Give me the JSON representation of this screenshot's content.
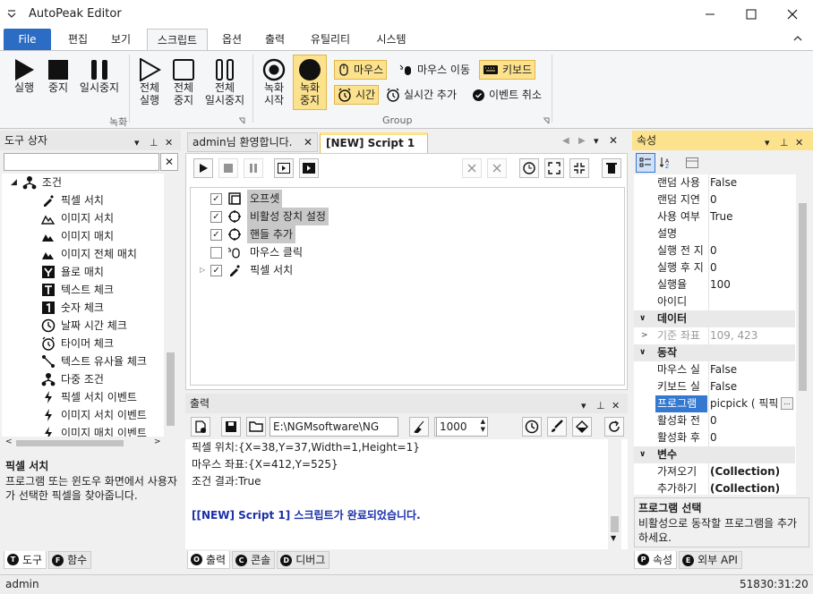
{
  "window": {
    "title": "AutoPeak Editor"
  },
  "ribbon_tabs": [
    "File",
    "편집",
    "보기",
    "스크립트",
    "옵션",
    "출력",
    "유틸리티",
    "시스템"
  ],
  "ribbon": {
    "rec_group": {
      "play": "실행",
      "stop": "중지",
      "pause": "일시중지",
      "play_all": [
        "전체",
        "실행"
      ],
      "stop_all": [
        "전체",
        "중지"
      ],
      "pause_all": [
        "전체",
        "일시중지"
      ],
      "label": "녹화"
    },
    "group2": {
      "record_start": [
        "녹화",
        "시작"
      ],
      "record_stop": [
        "녹화",
        "중지"
      ],
      "mouse": "마우스",
      "mouse_move": "마우스 이동",
      "keyboard": "키보드",
      "time": "시간",
      "realtime_add": "실시간 추가",
      "event_cancel": "이벤트 취소",
      "label": "Group"
    }
  },
  "toolbox": {
    "title": "도구 상자",
    "search_value": "",
    "root": "조건",
    "items": [
      "픽셀 서치",
      "이미지 서치",
      "이미지 매치",
      "이미지 전체 매치",
      "욜로 매치",
      "텍스트 체크",
      "숫자 체크",
      "날짜 시간 체크",
      "타이머 체크",
      "텍스트 유사율 체크",
      "다중 조건",
      "픽셀 서치 이벤트",
      "이미지 서치 이벤트",
      "이미지 매치 이벤트"
    ],
    "desc_title": "픽셀 서치",
    "desc_text": "프로그램 또는 윈도우 화면에서 사용자가 선택한 픽셀을 찾아줍니다.",
    "tabs": [
      "도구",
      "함수"
    ]
  },
  "doc_tabs": [
    "admin님 환영합니다.",
    "[NEW] Script 1"
  ],
  "script_tree": [
    {
      "label": "오프셋",
      "checked": true,
      "highlight": true
    },
    {
      "label": "비활성 장치 설정",
      "checked": true,
      "highlight": true
    },
    {
      "label": "핸들 추가",
      "checked": true,
      "highlight": true
    },
    {
      "label": "마우스 클릭",
      "checked": false,
      "highlight": false
    },
    {
      "label": "픽셀 서치",
      "checked": true,
      "highlight": false
    }
  ],
  "output": {
    "title": "출력",
    "path": "E:\\NGMsoftware\\NG",
    "count": "1000",
    "lines": [
      "픽셀 위치:{X=38,Y=37,Width=1,Height=1}",
      "마우스 좌표:{X=412,Y=525}",
      "조건 결과:True",
      "",
      "[[NEW] Script 1] 스크립트가 완료되었습니다."
    ],
    "tabs": [
      "출력",
      "콘솔",
      "디버그"
    ]
  },
  "properties": {
    "title": "속성",
    "rows": [
      {
        "name": "랜덤 사용",
        "value": "False"
      },
      {
        "name": "랜덤 지연",
        "value": "0"
      },
      {
        "name": "사용 여부",
        "value": "True"
      },
      {
        "name": "설명",
        "value": ""
      },
      {
        "name": "실행 전 지",
        "value": "0"
      },
      {
        "name": "실행 후 지",
        "value": "0"
      },
      {
        "name": "실행율",
        "value": "100"
      },
      {
        "name": "아이디",
        "value": ""
      }
    ],
    "cat_data": "데이터",
    "base_coord": {
      "name": "기준 좌표",
      "value": "109, 423"
    },
    "cat_action": "동작",
    "action_rows": [
      {
        "name": "마우스 실",
        "value": "False"
      },
      {
        "name": "키보드 실",
        "value": "False"
      },
      {
        "name": "프로그램",
        "value": "picpick ( 픽픽"
      },
      {
        "name": "활성화 전",
        "value": "0"
      },
      {
        "name": "활성화 후",
        "value": "0"
      }
    ],
    "cat_var": "변수",
    "var_rows": [
      {
        "name": "가져오기",
        "value": "(Collection)"
      },
      {
        "name": "추가하기",
        "value": "(Collection)"
      }
    ],
    "desc_title": "프로그램 선택",
    "desc_text": "비활성으로 동작할 프로그램을 추가하세요.",
    "tabs": [
      "속성",
      "외부 API"
    ]
  },
  "status": {
    "user": "admin",
    "time": "51830:31:20"
  },
  "colors": {
    "accent": "#2b6cc4",
    "highlight": "#fce28d",
    "selected": "#3478d0",
    "link_text": "#1a2fa8"
  }
}
